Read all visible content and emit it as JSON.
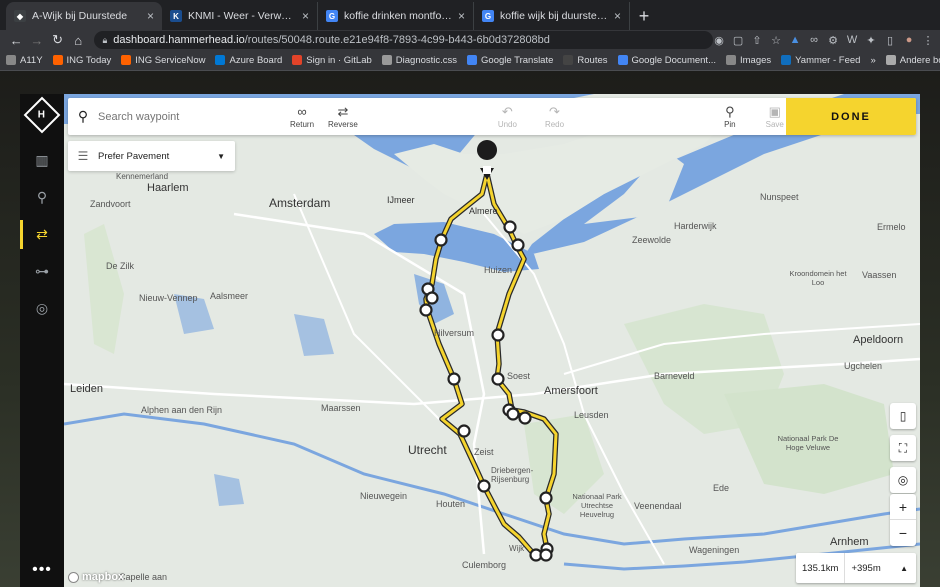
{
  "browser": {
    "tabs": [
      {
        "title": "A-Wijk bij Duurstede",
        "active": true,
        "favicon_color": "#3c4043"
      },
      {
        "title": "KNMI - Weer - Verwachtingen",
        "active": false,
        "favicon_color": "#1a4d8f"
      },
      {
        "title": "koffie drinken montfoort - Goo",
        "active": false,
        "favicon_color": "#4285f4"
      },
      {
        "title": "koffie wijk bij duurstede - Goo",
        "active": false,
        "favicon_color": "#4285f4"
      }
    ],
    "url_host": "dashboard.hammerhead.io",
    "url_path": "/routes/50048.route.e21e94f8-7893-4c99-b443-6b0d372808bd",
    "bookmarks": [
      {
        "label": "A11Y",
        "color": "#888888"
      },
      {
        "label": "ING Today",
        "color": "#ff6200"
      },
      {
        "label": "ING ServiceNow",
        "color": "#ff6200"
      },
      {
        "label": "Azure Board",
        "color": "#0078d4"
      },
      {
        "label": "Sign in · GitLab",
        "color": "#e24329"
      },
      {
        "label": "Diagnostic.css",
        "color": "#999999"
      },
      {
        "label": "Google Translate",
        "color": "#4285f4"
      },
      {
        "label": "Routes",
        "color": "#444444"
      },
      {
        "label": "Google Document...",
        "color": "#4285f4"
      },
      {
        "label": "Images",
        "color": "#888888"
      },
      {
        "label": "Yammer - Feed",
        "color": "#106ebe"
      }
    ],
    "other_bookmarks": "Andere bookmarks"
  },
  "toolbar": {
    "search_placeholder": "Search waypoint",
    "return_label": "Return",
    "reverse_label": "Reverse",
    "undo_label": "Undo",
    "redo_label": "Redo",
    "pin_label": "Pin",
    "save_label": "Save",
    "done_label": "DONE"
  },
  "route_preference": "Prefer Pavement",
  "stats": {
    "distance": "135.1km",
    "elevation": "+395m"
  },
  "attribution": "mapbox",
  "map_labels": {
    "haarlem": "Haarlem",
    "amsterdam": "Amsterdam",
    "ijmeer": "IJmeer",
    "almere": "Almere",
    "zandvoort": "Zandvoort",
    "kennemerland": "Kennemerland",
    "nunspeet": "Nunspeet",
    "harderwijk": "Harderwijk",
    "zeewolde": "Zeewolde",
    "ermelo": "Ermelo",
    "vaassen": "Vaassen",
    "kroondomein": "Kroondomein het Loo",
    "apeldoorn": "Apeldoorn",
    "ugchelen": "Ugchelen",
    "dezilk": "De Zilk",
    "nieuwvennep": "Nieuw-Vennep",
    "aalsmeer": "Aalsmeer",
    "huizen": "Huizen",
    "hilversum": "Hilversum",
    "soest": "Soest",
    "amersfoort": "Amersfoort",
    "leusden": "Leusden",
    "barneveld": "Barneveld",
    "leiden": "Leiden",
    "alphen": "Alphen aan den Rijn",
    "maarssen": "Maarssen",
    "utrecht": "Utrecht",
    "zeist": "Zeist",
    "driebergen": "Driebergen-Rijsenburg",
    "nieuwegein": "Nieuwegein",
    "houten": "Houten",
    "veenendaal": "Veenendaal",
    "ede": "Ede",
    "nationalpark": "Nationaal Park Utrechtse Heuvelrug",
    "hogeveluwe": "Nationaal Park De Hoge Veluwe",
    "wageningen": "Wageningen",
    "culemborg": "Culemborg",
    "arnhem": "Arnhem",
    "capelle": "Capelle aan",
    "wijk": "Wijk"
  }
}
